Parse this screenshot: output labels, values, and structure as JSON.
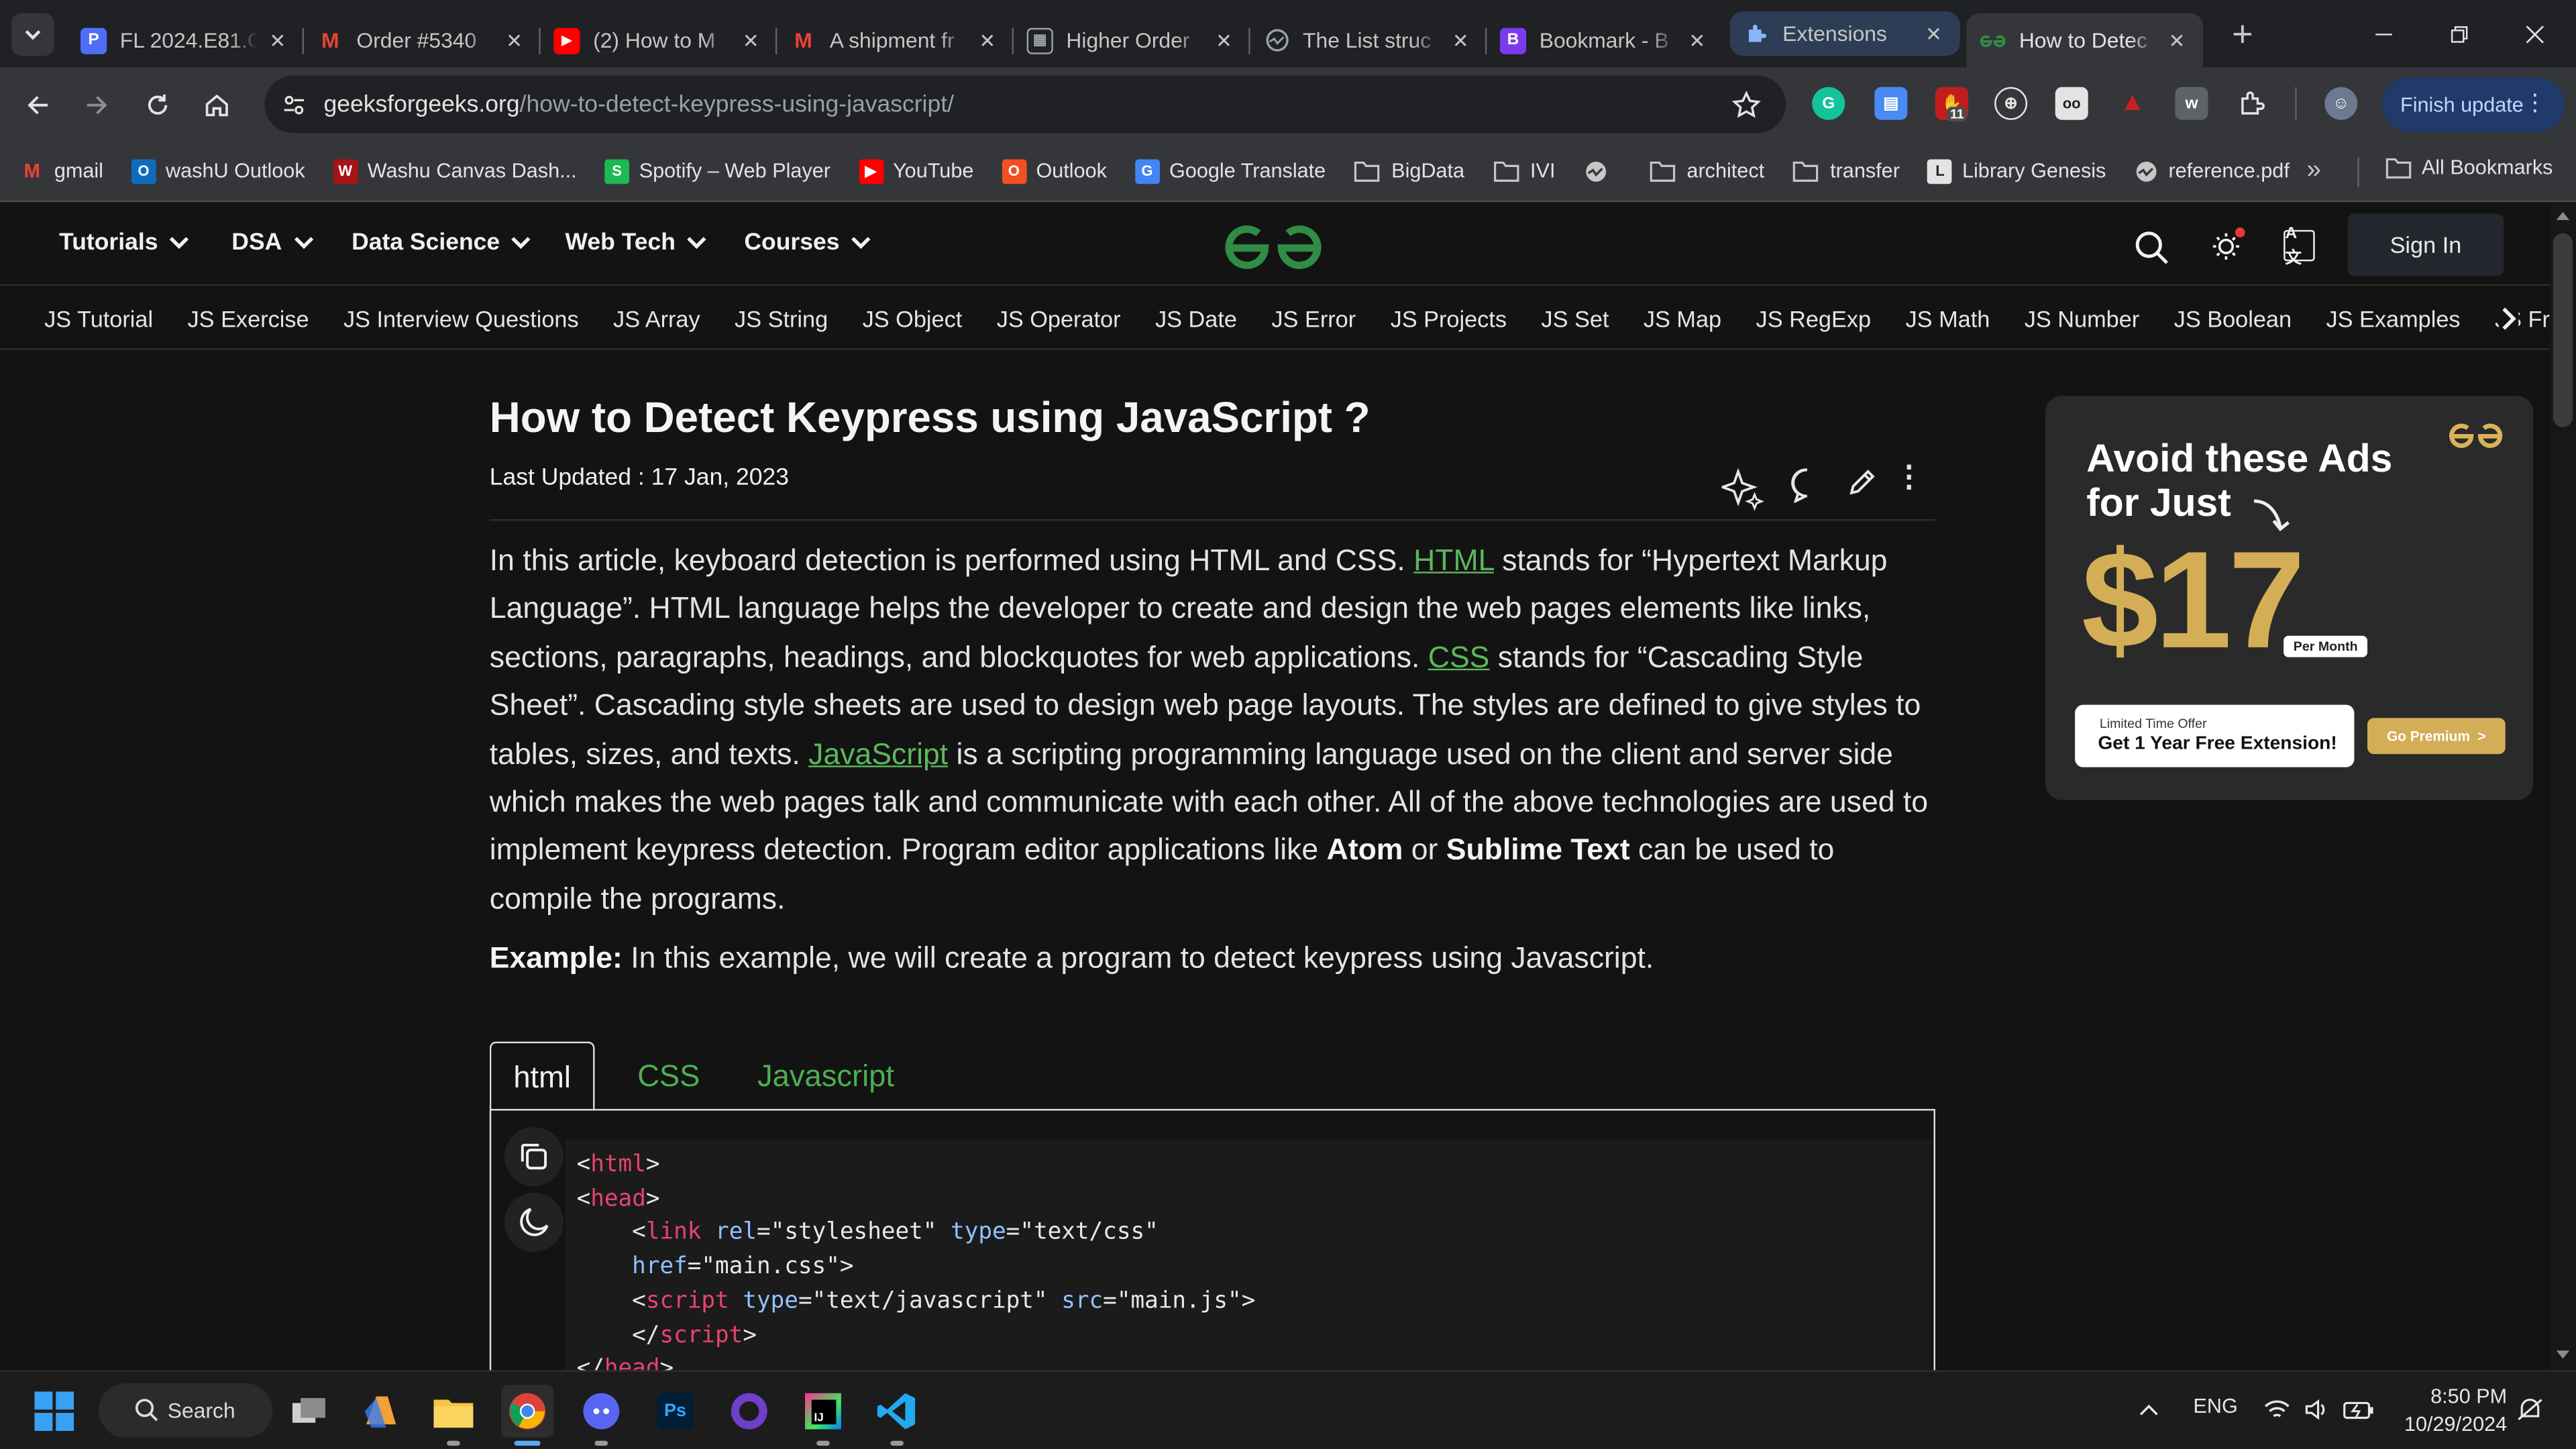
{
  "browser": {
    "tabs": [
      {
        "title": "FL 2024.E81.C",
        "favicon": "P",
        "color": "#4f6ef7"
      },
      {
        "title": "Order #5340",
        "favicon": "M",
        "color": "#ea4335"
      },
      {
        "title": "(2) How to M",
        "favicon": "yt-icon",
        "color": "#ff0000"
      },
      {
        "title": "A shipment fr",
        "favicon": "M",
        "color": "#ea4335"
      },
      {
        "title": "Higher Order",
        "favicon": "hl-icon",
        "color": "#9aa0a6"
      },
      {
        "title": "The List struc",
        "favicon": "globe-icon",
        "color": "#9aa0a6"
      },
      {
        "title": "Bookmark - B",
        "favicon": "B",
        "color": "#7c3aed"
      },
      {
        "title": "Extensions",
        "favicon": "puzzle-icon",
        "color": "#8ab4f8"
      },
      {
        "title": "How to Detec",
        "favicon": "gfg-icon",
        "color": "#2f8d46"
      }
    ],
    "url_domain": "geeksforgeeks.org",
    "url_path": "/how-to-detect-keypress-using-javascript/",
    "finish_update": "Finish update",
    "ext_badge": "11",
    "bookmarks": [
      {
        "label": "gmail",
        "icon": "M",
        "color": "#ea4335"
      },
      {
        "label": "washU Outlook",
        "icon": "O",
        "color": "#0f6cbd"
      },
      {
        "label": "Washu Canvas Dash...",
        "icon": "W",
        "color": "#a51417"
      },
      {
        "label": "Spotify – Web Player",
        "icon": "S",
        "color": "#1db954"
      },
      {
        "label": "YouTube",
        "icon": "▶",
        "color": "#ff0000"
      },
      {
        "label": "Outlook",
        "icon": "O",
        "color": "#f25022"
      },
      {
        "label": "Google Translate",
        "icon": "G",
        "color": "#4285f4"
      },
      {
        "label": "BigData",
        "icon": "folder",
        "color": "#c4c7c5"
      },
      {
        "label": "IVI",
        "icon": "folder",
        "color": "#c4c7c5"
      },
      {
        "label": "",
        "icon": "globe",
        "color": "#c4c7c5"
      },
      {
        "label": "architect",
        "icon": "folder",
        "color": "#c4c7c5"
      },
      {
        "label": "transfer",
        "icon": "folder",
        "color": "#c4c7c5"
      },
      {
        "label": "Library Genesis",
        "icon": "L",
        "color": "#e3e3e3"
      },
      {
        "label": "reference.pdf",
        "icon": "globe",
        "color": "#c4c7c5"
      }
    ],
    "more_bookmarks": "»",
    "all_bookmarks": "All Bookmarks"
  },
  "site": {
    "menu": [
      "Tutorials",
      "DSA",
      "Data Science",
      "Web Tech",
      "Courses"
    ],
    "sign_in": "Sign In",
    "subnav": [
      "JS Tutorial",
      "JS Exercise",
      "JS Interview Questions",
      "JS Array",
      "JS String",
      "JS Object",
      "JS Operator",
      "JS Date",
      "JS Error",
      "JS Projects",
      "JS Set",
      "JS Map",
      "JS RegExp",
      "JS Math",
      "JS Number",
      "JS Boolean",
      "JS Examples",
      "JS Free"
    ]
  },
  "article": {
    "title": "How to Detect Keypress using JavaScript ?",
    "updated": "Last Updated : 17 Jan, 2023",
    "p1_a": "In this article, keyboard detection is performed using HTML and CSS. ",
    "link_html": "HTML",
    "p1_b": " stands for “Hypertext Markup Language”. HTML language helps the developer to create and design the web pages elements like links, sections, paragraphs, headings, and blockquotes for web applications. ",
    "link_css": "CSS",
    "p1_c": " stands for “Cascading Style Sheet”. Cascading style sheets are used to design web page layouts. The styles are defined to give styles to tables, sizes, and texts. ",
    "link_js": "JavaScript",
    "p1_d": " is a scripting programming language used on the client and server side which makes the web pages talk and communicate with each other. All of the above technologies are used to implement keypress detection. Program editor applications like ",
    "atom": "Atom",
    "p1_e": " or ",
    "sublime": "Sublime Text",
    "p1_f": " can be used to compile the programs.",
    "example_label": "Example:",
    "example_text": " In this example, we will create a program to detect keypress using Javascript.",
    "code_tabs": [
      "html",
      "CSS",
      "Javascript"
    ]
  },
  "ad": {
    "line1": "Avoid these Ads",
    "line2": "for Just",
    "price": "$17",
    "per": "Per Month",
    "offer_small": "Limited Time Offer",
    "offer_big": "Get 1 Year Free Extension!",
    "cta": "Go Premium  >"
  },
  "taskbar": {
    "search": "Search",
    "lang": "ENG",
    "time": "8:50 PM",
    "date": "10/29/2024"
  }
}
